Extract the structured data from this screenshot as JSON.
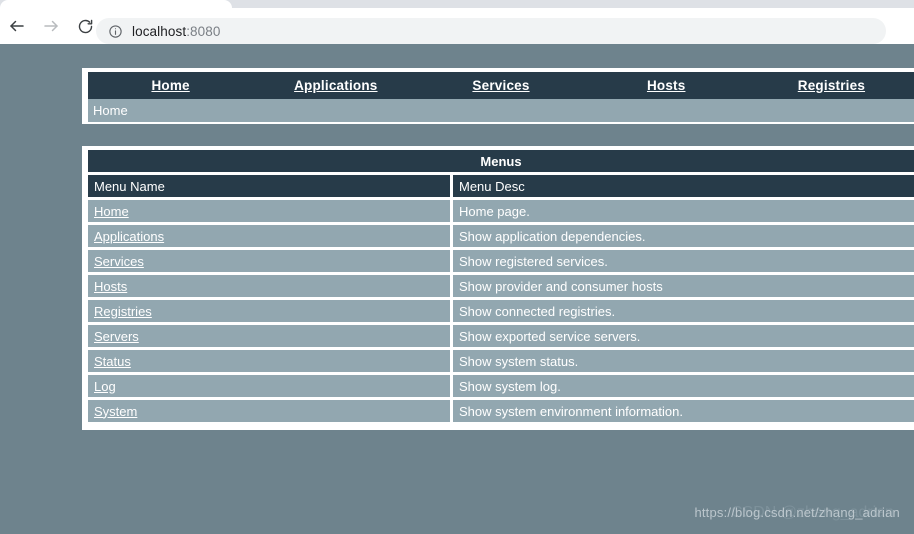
{
  "browser": {
    "url_host": "localhost",
    "url_port": ":8080",
    "back_icon": "arrow-left-icon",
    "forward_icon": "arrow-right-icon",
    "reload_icon": "reload-icon",
    "site_info_icon": "info-circle-icon"
  },
  "navbar": {
    "items": [
      {
        "label": "Home"
      },
      {
        "label": "Applications"
      },
      {
        "label": "Services"
      },
      {
        "label": "Hosts"
      },
      {
        "label": "Registries"
      }
    ]
  },
  "breadcrumb": {
    "text": "Home"
  },
  "menus_panel": {
    "title": "Menus",
    "columns": {
      "name": "Menu Name",
      "desc": "Menu Desc"
    },
    "rows": [
      {
        "name": "Home",
        "desc": "Home page."
      },
      {
        "name": "Applications",
        "desc": "Show application dependencies."
      },
      {
        "name": "Services",
        "desc": "Show registered services."
      },
      {
        "name": "Hosts",
        "desc": "Show provider and consumer hosts"
      },
      {
        "name": "Registries",
        "desc": "Show connected registries."
      },
      {
        "name": "Servers",
        "desc": "Show exported service servers."
      },
      {
        "name": "Status",
        "desc": "Show system status."
      },
      {
        "name": "Log",
        "desc": "Show system log."
      },
      {
        "name": "System",
        "desc": "Show system environment information."
      }
    ]
  },
  "watermark": {
    "text": "https://blog.csdn.net/zhang_adrian",
    "overlay_text": "CSDN @zhang_adrian"
  },
  "colors": {
    "page_background": "#6e838d",
    "panel_dark": "#273b49",
    "row_fill": "#92a7b0",
    "border": "#ffffff"
  }
}
